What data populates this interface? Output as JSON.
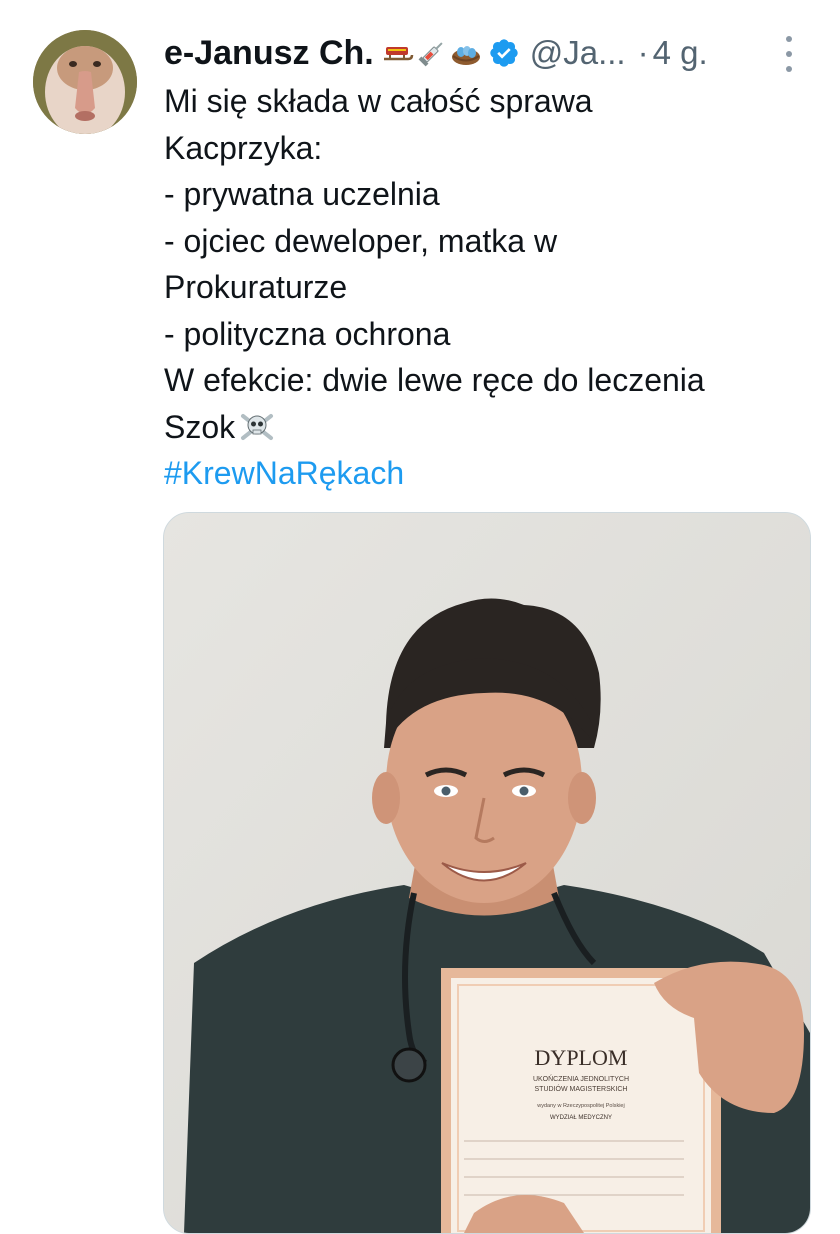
{
  "tweet": {
    "display_name": "e-Janusz Ch.",
    "badges": [
      "sled-emoji",
      "syringe-emoji",
      "nest-with-eggs-emoji"
    ],
    "verified": true,
    "handle": "@Ja...",
    "separator": "·",
    "time": "4 g.",
    "lines": [
      "Mi się składa w całość sprawa",
      "Kacprzyka:",
      "- prywatna uczelnia",
      "- ojciec deweloper, matka w",
      "Prokuraturze",
      "- polityczna ochrona",
      "W efekcie: dwie lewe ręce do leczenia",
      "Szok"
    ],
    "hashtag": "#KrewNaRękach",
    "colors": {
      "text": "#0f1419",
      "secondary": "#536471",
      "link": "#1d9bf0",
      "verified": "#1d9bf0"
    }
  },
  "media": {
    "diploma": {
      "title": "DYPLOM",
      "subtitle_1": "UKOŃCZENIA JEDNOLITYCH",
      "subtitle_2": "STUDIÓW MAGISTERSKICH",
      "issued": "wydany w Rzeczypospolitej Polskiej",
      "faculty": "WYDZIAŁ MEDYCZNY"
    }
  }
}
